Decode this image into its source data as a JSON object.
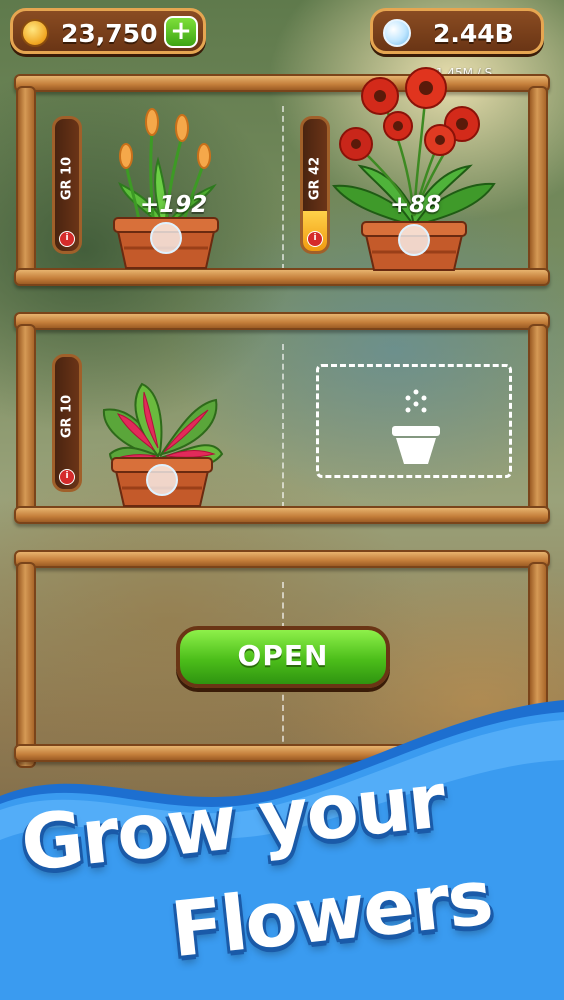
{
  "hud": {
    "coins": "23,750",
    "coin_icon": "gold-coin-icon",
    "add_icon": "plus-icon",
    "bubbles": "2.44B",
    "bubble_icon": "bubble-icon",
    "income_rate": "+ 1.45M / S"
  },
  "shelves": [
    {
      "slots": [
        {
          "grade": "GR 10",
          "grade_progress": 0.0,
          "gain": "+192",
          "plant": "orange-tulip-plant"
        },
        {
          "grade": "GR 42",
          "grade_progress": 0.3,
          "gain": "+88",
          "plant": "red-gerbera-plant"
        }
      ]
    },
    {
      "slots": [
        {
          "grade": "GR 10",
          "grade_progress": 0.0,
          "plant": "caladium-plant"
        },
        {
          "empty": true,
          "icon": "empty-pot-seeds-icon"
        }
      ]
    },
    {
      "open_label": "OPEN"
    }
  ],
  "banner": {
    "line1": "Grow your",
    "line2": "Flowers"
  },
  "colors": {
    "wood": "#c47e3a",
    "green_button": "#4cbe1a",
    "banner_blue": "#2f8be6"
  }
}
